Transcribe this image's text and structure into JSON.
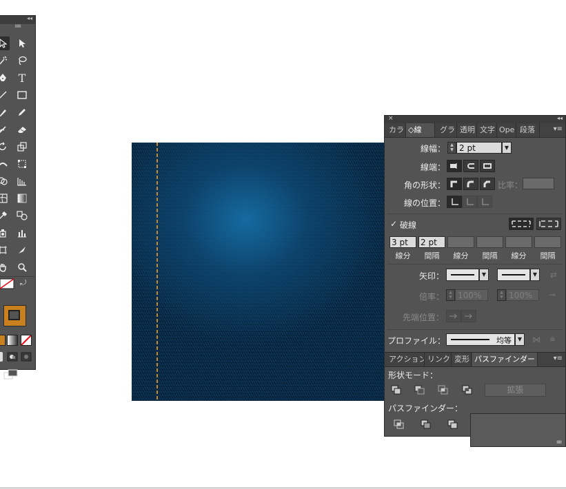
{
  "tools_panel": {
    "collapse_glyph": "◂◂",
    "grip": "IIIIIIIIIII"
  },
  "stroke_panel": {
    "close_glyph": "×",
    "collapse_glyph": "◂◂",
    "tabs": [
      {
        "label": "カラ",
        "active": false
      },
      {
        "label": "◇線",
        "active": true
      },
      {
        "label": "グラ",
        "active": false
      },
      {
        "label": "透明",
        "active": false
      },
      {
        "label": "文字",
        "active": false
      },
      {
        "label": "Ope",
        "active": false
      },
      {
        "label": "段落",
        "active": false
      }
    ],
    "menu_glyph": "▾≡",
    "weight": {
      "label": "線幅：",
      "value": "2 pt"
    },
    "cap": {
      "label": "線端："
    },
    "corner": {
      "label": "角の形状：",
      "limit_label": "比率："
    },
    "align": {
      "label": "線の位置："
    },
    "dashed": {
      "checkbox": "✓",
      "label": "破線",
      "checked": true
    },
    "dash_fields": [
      {
        "value": "3 pt",
        "label": "線分"
      },
      {
        "value": "2 pt",
        "label": "間隔"
      },
      {
        "value": "",
        "label": "線分"
      },
      {
        "value": "",
        "label": "間隔"
      },
      {
        "value": "",
        "label": "線分"
      },
      {
        "value": "",
        "label": "間隔"
      }
    ],
    "arrowheads": {
      "label": "矢印："
    },
    "scale": {
      "label": "倍率：",
      "start": "100%",
      "end": "100%"
    },
    "align_arrow": {
      "label": "先端位置："
    },
    "profile": {
      "label": "プロファイル：",
      "value": "均等"
    }
  },
  "pathfinder_panel": {
    "tabs": [
      {
        "label": "アクション",
        "active": false
      },
      {
        "label": "リンク",
        "active": false
      },
      {
        "label": "変形",
        "active": false
      },
      {
        "label": "パスファインダー",
        "active": true
      }
    ],
    "menu_glyph": "▾≡",
    "shape_modes_label": "形状モード：",
    "expand_label": "拡張",
    "pathfinders_label": "パスファインダー："
  },
  "colors": {
    "panel_bg": "#535353",
    "denim": "#0c3354",
    "stitch": "#c88a2c",
    "stroke_swatch": "#c8811e"
  }
}
